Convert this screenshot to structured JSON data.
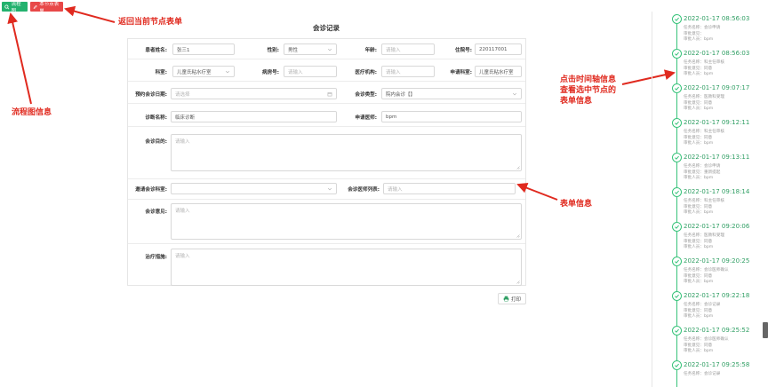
{
  "toolbar": {
    "flow_label": "流程图",
    "back_label": "本节点表单"
  },
  "form": {
    "title": "会诊记录",
    "patient_name": {
      "label": "患者姓名:",
      "value": "张三1"
    },
    "gender": {
      "label": "性别:",
      "value": "男性"
    },
    "age": {
      "label": "年龄:",
      "placeholder": "请输入"
    },
    "hospital_no": {
      "label": "住院号:",
      "value": "220117001"
    },
    "department": {
      "label": "科室:",
      "value": "儿童氏粘水疗室"
    },
    "ward_no": {
      "label": "病房号:",
      "placeholder": "请输入"
    },
    "institution": {
      "label": "医疗机构:",
      "placeholder": "请输入"
    },
    "apply_department": {
      "label": "申请科室:",
      "value": "儿童氏粘水疗室"
    },
    "appointment_date": {
      "label": "预约会诊日期:",
      "placeholder": "请选择"
    },
    "consult_type": {
      "label": "会诊类型:",
      "value": "院内会诊【】"
    },
    "diagnosis": {
      "label": "诊断名称:",
      "value": "临床诊断"
    },
    "apply_doctor": {
      "label": "申请医师:",
      "value": "bpm"
    },
    "purpose": {
      "label": "会诊目的:",
      "placeholder": "请输入"
    },
    "invite_department": {
      "label": "邀请会诊科室:"
    },
    "doctor_list": {
      "label": "会诊医师列表:",
      "placeholder": "请输入"
    },
    "opinion": {
      "label": "会诊意见:",
      "placeholder": "请输入"
    },
    "treatment": {
      "label": "治疗措施:",
      "placeholder": "请输入"
    },
    "print_label": "打印"
  },
  "annotations": {
    "back_form": "返回当前节点表单",
    "flowchart": "流程图信息",
    "timeline_hint": "点击时间轴信息\n查看选中节点的\n表单信息",
    "form_info": "表单信息"
  },
  "timeline": [
    {
      "time": "2022-01-17 08:56:03",
      "task": "任务名称：会诊申请",
      "opinion": "审批意见：",
      "approver": "审批人员：bpm"
    },
    {
      "time": "2022-01-17 08:56:03",
      "task": "任务名称：科主任审核",
      "opinion": "审批意见：同意",
      "approver": "审批人员：bpm"
    },
    {
      "time": "2022-01-17 09:07:17",
      "task": "任务名称：医教科受理",
      "opinion": "审批意见：同意",
      "approver": "审批人员：bpm"
    },
    {
      "time": "2022-01-17 09:12:11",
      "task": "任务名称：科主任审核",
      "opinion": "审批意见：同意",
      "approver": "审批人员：bpm"
    },
    {
      "time": "2022-01-17 09:13:11",
      "task": "任务名称：会诊申请",
      "opinion": "审批意见：重新提起",
      "approver": "审批人员：bpm"
    },
    {
      "time": "2022-01-17 09:18:14",
      "task": "任务名称：科主任审核",
      "opinion": "审批意见：同意",
      "approver": "审批人员：bpm"
    },
    {
      "time": "2022-01-17 09:20:06",
      "task": "任务名称：医教科受理",
      "opinion": "审批意见：同意",
      "approver": "审批人员：bpm"
    },
    {
      "time": "2022-01-17 09:20:25",
      "task": "任务名称：会诊医师确认",
      "opinion": "审批意见：同意",
      "approver": "审批人员：bpm"
    },
    {
      "time": "2022-01-17 09:22:18",
      "task": "任务名称：会诊记录",
      "opinion": "审批意见：同意",
      "approver": "审批人员：bpm"
    },
    {
      "time": "2022-01-17 09:25:52",
      "task": "任务名称：会诊医师确认",
      "opinion": "审批意见：同意",
      "approver": "审批人员：bpm"
    },
    {
      "time": "2022-01-17 09:25:58",
      "task": "任务名称：会诊记录",
      "opinion": "",
      "approver": ""
    }
  ]
}
